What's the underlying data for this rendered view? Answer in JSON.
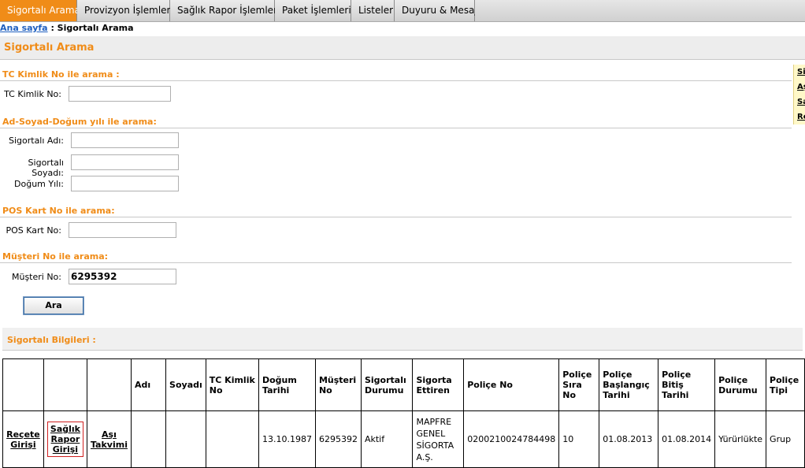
{
  "nav": {
    "tabs": [
      "Sigortalı Arama",
      "Provizyon İşlemleri",
      "Sağlık Rapor İşlemleri",
      "Paket İşlemleri",
      "Listeler",
      "Duyuru & Mesaj"
    ],
    "active": "Sigortalı Arama"
  },
  "breadcrumb": {
    "home": "Ana sayfa",
    "sep": " : ",
    "current": "Sigortalı Arama"
  },
  "page_title": "Sigortalı Arama",
  "sections": {
    "tc": "TC Kimlik No ile arama :",
    "name": "Ad-Soyad-Doğum yılı ile arama:",
    "pos": "POS Kart No ile arama:",
    "musteri": "Müşteri No ile arama:"
  },
  "fields": {
    "tc_label": "TC Kimlik No:",
    "tc_value": "",
    "ad_label": "Sigortalı Adı:",
    "ad_value": "",
    "soyad_label": "Sigortalı Soyadı:",
    "soyad_value": "",
    "dogum_label": "Doğum Yılı:",
    "dogum_value": "",
    "pos_label": "POS Kart No:",
    "pos_value": "",
    "musteri_label": "Müşteri No:",
    "musteri_value": "6295392"
  },
  "search_button": "Ara",
  "side_links": [
    "Sig",
    "Aş",
    "Sa",
    "Re"
  ],
  "results_title": "Sigortalı Bilgileri :",
  "table": {
    "headers": [
      "",
      "",
      "",
      "Adı",
      "Soyadı",
      "TC Kimlik No",
      "Doğum Tarihi",
      "Müşteri No",
      "Sigortalı Durumu",
      "Sigorta Ettiren",
      "Poliçe No",
      "Poliçe Sıra No",
      "Poliçe Başlangıç Tarihi",
      "Poliçe Bitiş Tarihi",
      "Poliçe Durumu",
      "Poliçe Tipi"
    ],
    "row": {
      "recete": "Reçete Girişi",
      "rapor": "Sağlık Rapor Girişi",
      "asi": "Aşı Takvimi",
      "adi": "",
      "soyadi": "",
      "tc": "",
      "dogum": "13.10.1987",
      "musteri": "6295392",
      "durum": "Aktif",
      "ettiren": "MAPFRE GENEL SİGORTA A.Ş.",
      "police_no": "0200210024784498",
      "sira": "10",
      "baslangic": "01.08.2013",
      "bitis": "01.08.2014",
      "police_durum": "Yürürlükte",
      "tip": "Grup"
    }
  }
}
